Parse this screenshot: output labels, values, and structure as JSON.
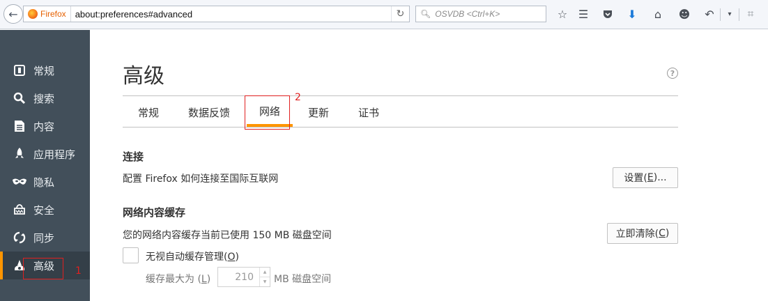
{
  "toolbar": {
    "identity_label": "Firefox",
    "url": "about:preferences#advanced",
    "search_placeholder": "OSVDB <Ctrl+K>",
    "icons": [
      "back-icon",
      "reload-icon",
      "search-icon",
      "bookmark-star-icon",
      "reading-list-icon",
      "pocket-icon",
      "download-icon",
      "home-icon",
      "smiley-icon",
      "undo-icon",
      "dropdown-icon",
      "crop-icon"
    ]
  },
  "sidebar": {
    "items": [
      {
        "label": "常规",
        "icon": "general-icon"
      },
      {
        "label": "搜索",
        "icon": "search-icon"
      },
      {
        "label": "内容",
        "icon": "content-icon"
      },
      {
        "label": "应用程序",
        "icon": "applications-icon"
      },
      {
        "label": "隐私",
        "icon": "privacy-mask-icon"
      },
      {
        "label": "安全",
        "icon": "security-icon"
      },
      {
        "label": "同步",
        "icon": "sync-icon"
      },
      {
        "label": "高级",
        "icon": "advanced-icon",
        "selected": true
      }
    ]
  },
  "annotations": {
    "marker1": "1",
    "marker2": "2",
    "color": "#e02020"
  },
  "main": {
    "title": "高级",
    "tabs": [
      {
        "label": "常规"
      },
      {
        "label": "数据反馈"
      },
      {
        "label": "网络",
        "selected": true
      },
      {
        "label": "更新"
      },
      {
        "label": "证书"
      }
    ],
    "connection": {
      "heading": "连接",
      "description": "配置 Firefox 如何连接至国际互联网",
      "button_pre": "设置(",
      "button_key": "E",
      "button_post": ")..."
    },
    "cache": {
      "heading": "网络内容缓存",
      "description": "您的网络内容缓存当前已使用 150 MB 磁盘空间",
      "clear_pre": "立即清除(",
      "clear_key": "C",
      "clear_post": ")",
      "override_pre": "无视自动缓存管理(",
      "override_key": "O",
      "override_post": ")",
      "override_checked": false,
      "limit_pre": "缓存最大为 (",
      "limit_key": "L",
      "limit_post": ")",
      "limit_value": "210",
      "limit_unit": "MB 磁盘空间"
    }
  },
  "colors": {
    "accent": "#ff9500",
    "sidebar_bg": "#424f5a",
    "sidebar_selected_bg": "#343f48"
  }
}
